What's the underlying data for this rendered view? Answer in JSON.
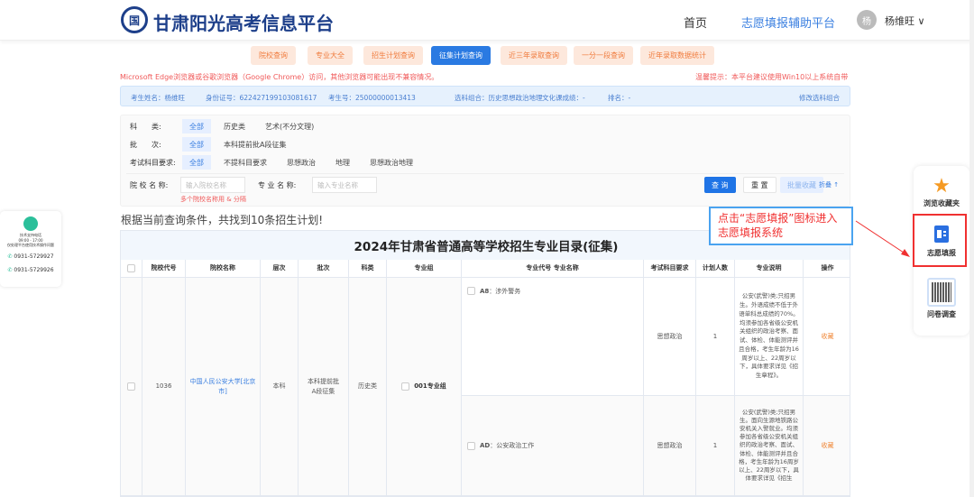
{
  "header": {
    "logo_text": "国",
    "site_title": "甘肃阳光高考信息平台",
    "nav": [
      "首页",
      "志愿填报辅助平台"
    ],
    "avatar_initial": "杨",
    "user_name": "杨维旺"
  },
  "tabs": [
    {
      "label": "院校查询",
      "active": false
    },
    {
      "label": "专业大全",
      "active": false
    },
    {
      "label": "招生计划查询",
      "active": false
    },
    {
      "label": "征集计划查询",
      "active": true
    },
    {
      "label": "近三年录取查询",
      "active": false
    },
    {
      "label": "一分一段查询",
      "active": false
    },
    {
      "label": "近年录取数据统计",
      "active": false
    }
  ],
  "warnings": {
    "left": "Microsoft Edge浏览器或谷歌浏览器（Google Chrome）访问，其他浏览器可能出现不兼容情况。",
    "right": "温馨提示：本平台建议使用Win10以上系统自带"
  },
  "info": {
    "name": "考生姓名：杨维旺",
    "id": "身份证号：622427199103081617",
    "exam_no": "考生号：25000000013413",
    "combo": "选科组合：历史思想政治地理",
    "score": "文化课成绩：-",
    "rank": "排名：-",
    "modify": "修改选科组合"
  },
  "filters": {
    "category": {
      "label": "科　　类:",
      "options": [
        "全部",
        "历史类",
        "艺术(不分文理)"
      ]
    },
    "batch": {
      "label": "批　　次:",
      "options": [
        "全部",
        "本科提前批A段征集"
      ]
    },
    "subject": {
      "label": "考试科目要求:",
      "options": [
        "全部",
        "不提科目要求",
        "思想政治",
        "地理",
        "思想政治地理"
      ]
    },
    "school_label": "院 校 名 称:",
    "school_placeholder": "输入院校名称",
    "school_hint": "多个院校名称用 & 分隔",
    "major_label": "专 业 名 称:",
    "major_placeholder": "输入专业名称",
    "query": "查 询",
    "reset": "重 置",
    "batch_fav": "批量收藏",
    "collapse": "折叠 ↑"
  },
  "result_text": "根据当前查询条件，共找到10条招生计划!",
  "table": {
    "title": "2024年甘肃省普通高等学校招生专业目录(征集)",
    "headers": [
      "院校代号",
      "院校名称",
      "层次",
      "批次",
      "科类",
      "专业组",
      "专业代号 专业名称",
      "考试科目要求",
      "计划人数",
      "专业说明",
      "操作"
    ],
    "group": {
      "code": "1036",
      "school": "中国人民公安大学[北京市]",
      "level": "本科",
      "batch": "本科提前批A段征集",
      "category": "历史类",
      "group": "001专业组"
    },
    "rows": [
      {
        "code": "A8",
        "name": "：涉外警务",
        "subject": "思想政治",
        "count": "1",
        "desc": "公安(武警)类;只招男生。外语成绩不低于外语单科总成绩的70%。均须参加各省级公安机关组织的政治考察、面试、体检、体能测评并且合格，考生年龄为16周岁以上、22周岁以下，具体要求详见《招生章程》。",
        "action": "收藏"
      },
      {
        "code": "AD",
        "name": "：公安政治工作",
        "subject": "思想政治",
        "count": "1",
        "desc": "公安(武警)类;只招男生。面向生源地铁路公安机关入警就业。均须参加各省级公安机关组织的政治考察、面试、体检、体能测评并且合格，考生年龄为16周岁以上、22周岁以下，具体要求详见《招生",
        "action": "收藏"
      }
    ]
  },
  "annotation": "点击“志愿填报”图标进入志愿填报系统",
  "side": {
    "favorites": "浏览收藏夹",
    "apply": "志愿填报",
    "survey": "问卷调查"
  },
  "support": {
    "title": "技术支持电话",
    "hours": "09:00 - 17:00",
    "note": "仅处理平台使用技术操作问题",
    "phone1": "0931-5729927",
    "phone2": "0931-5729926"
  }
}
